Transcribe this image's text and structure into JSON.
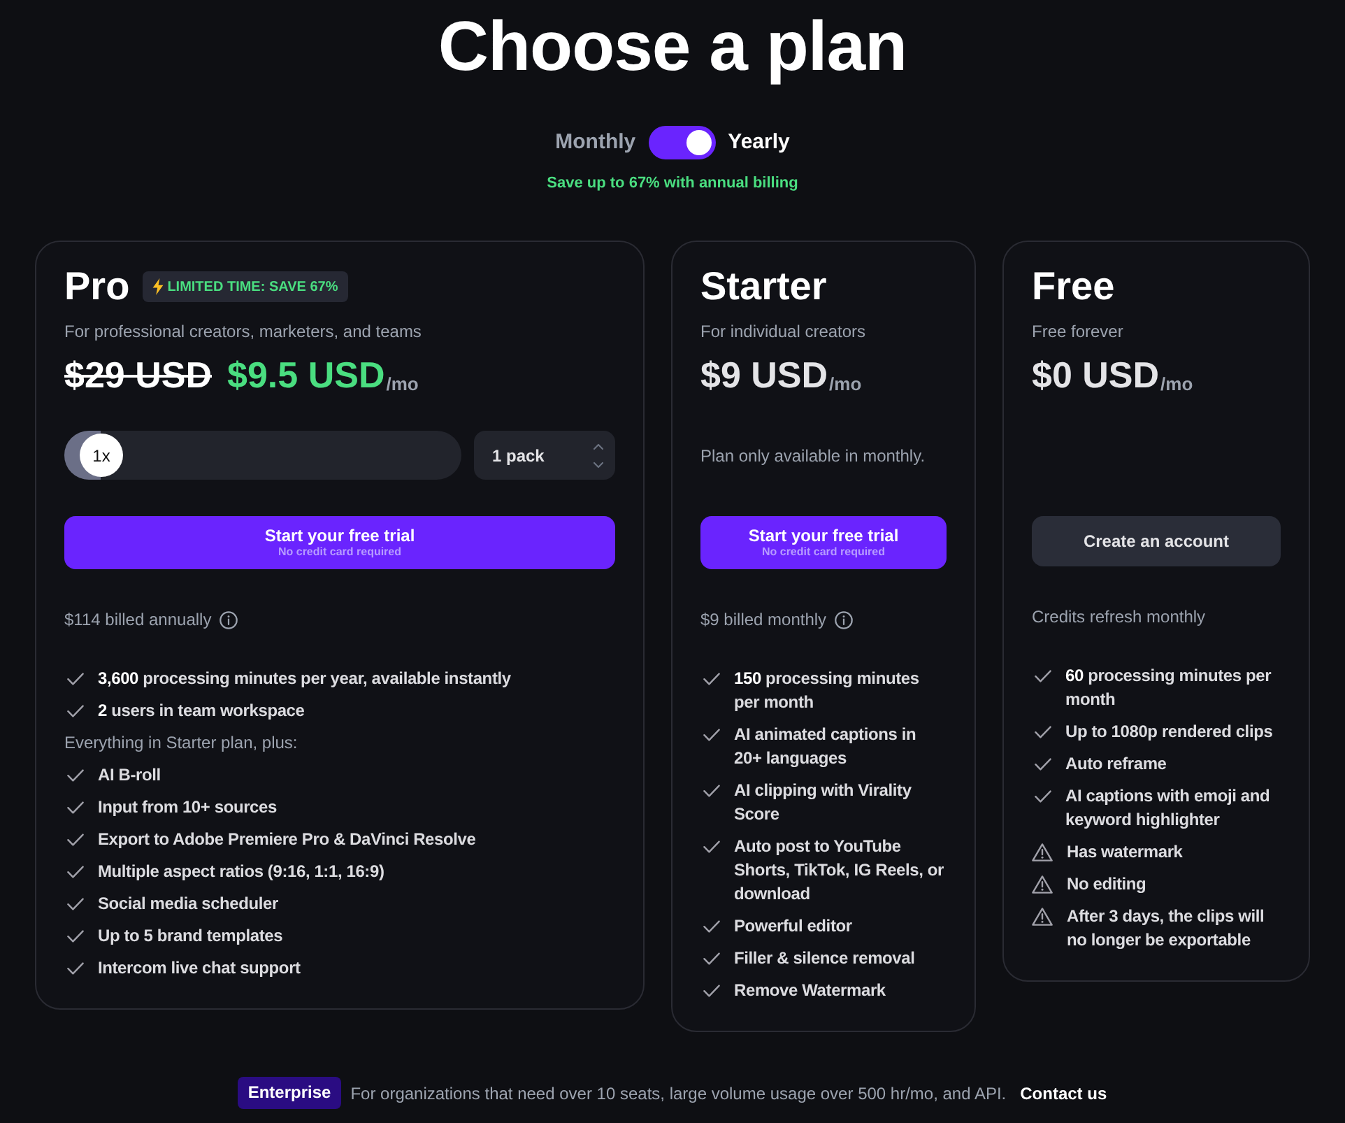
{
  "title": "Choose a plan",
  "billing_toggle": {
    "left_label": "Monthly",
    "right_label": "Yearly",
    "on": true
  },
  "savings_note": "Save up to 67% with annual billing",
  "plans": [
    {
      "name": "Pro",
      "badge": "LIMITED TIME: SAVE 67%",
      "description": "For professional creators, marketers, and teams",
      "old_price": "$29 USD",
      "price": "$9.5 USD",
      "period": "/mo",
      "pack_slider": {
        "thumb_label": "1x",
        "level": 0
      },
      "pack_select": {
        "value": "1 pack"
      },
      "cta": {
        "kind": "primary",
        "label": "Start your free trial",
        "sublabel": "No credit card required"
      },
      "billing_note": {
        "text": "$114 billed annually",
        "info_icon": true
      },
      "features": [
        {
          "kind": "check",
          "text": "**3,600** processing minutes per year, available instantly"
        },
        {
          "kind": "check",
          "text": "**2** users in team workspace"
        },
        {
          "kind": "heading",
          "text": "Everything in Starter plan, plus:"
        },
        {
          "kind": "check",
          "text": "AI B-roll"
        },
        {
          "kind": "check",
          "text": "Input from 10+ sources"
        },
        {
          "kind": "check",
          "text": "Export to Adobe Premiere Pro & DaVinci Resolve"
        },
        {
          "kind": "check",
          "text": "Multiple aspect ratios (9:16, 1:1, 16:9)"
        },
        {
          "kind": "check",
          "text": "Social media scheduler"
        },
        {
          "kind": "check",
          "text": "Up to 5 brand templates"
        },
        {
          "kind": "check",
          "text": "Intercom live chat support"
        }
      ]
    },
    {
      "name": "Starter",
      "description": "For individual creators",
      "price": "$9 USD",
      "period": "/mo",
      "availability_note": "Plan only available in monthly.",
      "cta": {
        "kind": "primary",
        "label": "Start your free trial",
        "sublabel": "No credit card required"
      },
      "billing_note": {
        "text": "$9 billed monthly",
        "info_icon": true
      },
      "features": [
        {
          "kind": "check",
          "text": "**150** processing minutes per month"
        },
        {
          "kind": "check",
          "text": "AI animated captions in 20+ languages"
        },
        {
          "kind": "check",
          "text": "AI clipping with Virality Score"
        },
        {
          "kind": "check",
          "text": "Auto post to YouTube Shorts, TikTok, IG Reels, or download"
        },
        {
          "kind": "check",
          "text": "Powerful editor"
        },
        {
          "kind": "check",
          "text": "Filler & silence removal"
        },
        {
          "kind": "check",
          "text": "Remove Watermark"
        }
      ]
    },
    {
      "name": "Free",
      "description": "Free forever",
      "price": "$0 USD",
      "period": "/mo",
      "cta": {
        "kind": "secondary",
        "label": "Create an account"
      },
      "billing_note": {
        "text": "Credits refresh monthly",
        "info_icon": false
      },
      "features": [
        {
          "kind": "check",
          "text": "**60** processing minutes per month"
        },
        {
          "kind": "check",
          "text": "Up to 1080p rendered clips"
        },
        {
          "kind": "check",
          "text": "Auto reframe"
        },
        {
          "kind": "check",
          "text": "AI captions with emoji and keyword highlighter"
        },
        {
          "kind": "warning",
          "text": "Has watermark"
        },
        {
          "kind": "warning",
          "text": "No editing"
        },
        {
          "kind": "warning",
          "text": "After 3 days, the clips will no longer be exportable"
        }
      ]
    }
  ],
  "enterprise": {
    "badge": "Enterprise",
    "text": "For organizations that need over 10 seats, large volume usage over 500 hr/mo, and API.",
    "link": "Contact us"
  }
}
